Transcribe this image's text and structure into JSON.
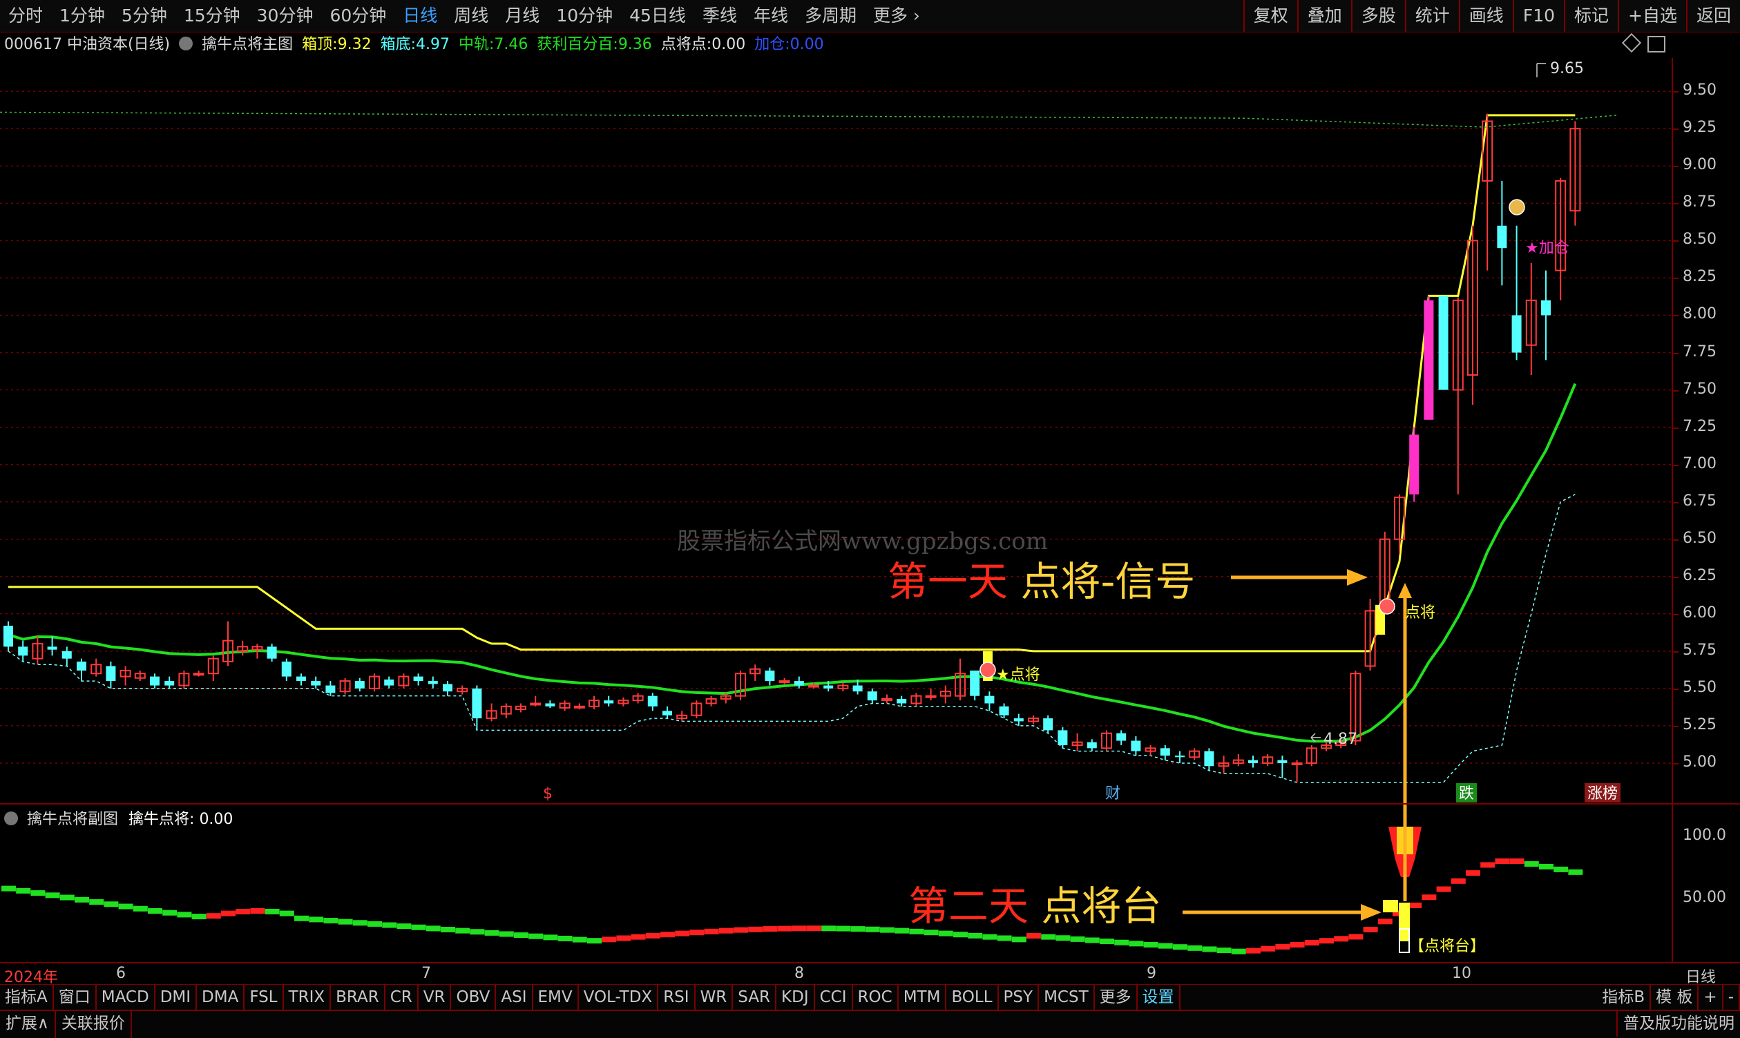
{
  "toolbar": {
    "left": [
      "分时",
      "1分钟",
      "5分钟",
      "15分钟",
      "30分钟",
      "60分钟",
      "日线",
      "周线",
      "月线",
      "10分钟",
      "45日线",
      "季线",
      "年线",
      "多周期",
      "更多"
    ],
    "active": "日线",
    "right": [
      "复权",
      "叠加",
      "多股",
      "统计",
      "画线",
      "F10",
      "标记",
      "+自选",
      "返回"
    ]
  },
  "info": {
    "stock": "000617 中油资本(日线)",
    "indicator": "擒牛点将主图",
    "box_top_label": "箱顶:",
    "box_top": "9.32",
    "box_bottom_label": "箱底:",
    "box_bottom": "4.97",
    "mid_label": "中轨:",
    "mid": "7.46",
    "profit_label": "获利百分百:",
    "profit": "9.36",
    "point_label": "点将点:",
    "point": "0.00",
    "add_label": "加仓:",
    "add": "0.00"
  },
  "colors": {
    "up": "#ff3a3a",
    "down": "#54ffff",
    "yellow": "#ffff30",
    "green": "#20e020",
    "magenta": "#ff30c8",
    "grid": "#7a0000"
  },
  "y_axis_main": [
    "9.50",
    "9.25",
    "9.00",
    "8.75",
    "8.50",
    "8.25",
    "8.00",
    "7.75",
    "7.50",
    "7.25",
    "7.00",
    "6.75",
    "6.50",
    "6.25",
    "6.00",
    "5.75",
    "5.50",
    "5.25",
    "5.00"
  ],
  "y_axis_sub": [
    "100.0",
    "50.00"
  ],
  "chart_labels": {
    "high": "9.65",
    "low": "4.87",
    "add_position": "★加仓",
    "point_mark": "点将",
    "point_mark2": "★点将",
    "stage": "【点将台】"
  },
  "markers": {
    "dollar": "$",
    "cai": "财",
    "die": "跌",
    "zhangbang": "涨榜"
  },
  "sub": {
    "title": "擒牛点将副图",
    "value_label": "擒牛点将:",
    "value": "0.00"
  },
  "dates": {
    "year": "2024年",
    "m6": "6",
    "m7": "7",
    "m8": "8",
    "m9": "9",
    "m10": "10",
    "right": "日线"
  },
  "annotations": {
    "first_red": "第一天",
    "first_yellow": " 点将-信号",
    "second_red": "第二天",
    "second_yellow": " 点将台"
  },
  "watermark": "股票指标公式网www.gpzbgs.com",
  "indicators": [
    "指标A",
    "窗口",
    "MACD",
    "DMI",
    "DMA",
    "FSL",
    "TRIX",
    "BRAR",
    "CR",
    "VR",
    "OBV",
    "ASI",
    "EMV",
    "VOL-TDX",
    "RSI",
    "WR",
    "SAR",
    "KDJ",
    "CCI",
    "ROC",
    "MTM",
    "BOLL",
    "PSY",
    "MCST",
    "更多",
    "设置"
  ],
  "indicators_right": [
    "指标B",
    "模 板",
    "+",
    "-"
  ],
  "bottom": [
    "扩展∧",
    "关联报价"
  ],
  "bottom_right": "普及版功能说明",
  "chart_data": {
    "type": "candlestick",
    "ylim": [
      4.75,
      9.7
    ],
    "candles": [
      [
        5.92,
        5.78,
        5.95,
        5.75
      ],
      [
        5.78,
        5.72,
        5.82,
        5.68
      ],
      [
        5.7,
        5.8,
        5.85,
        5.66
      ],
      [
        5.78,
        5.76,
        5.85,
        5.72
      ],
      [
        5.75,
        5.7,
        5.78,
        5.65
      ],
      [
        5.68,
        5.62,
        5.7,
        5.55
      ],
      [
        5.6,
        5.66,
        5.7,
        5.58
      ],
      [
        5.65,
        5.55,
        5.68,
        5.5
      ],
      [
        5.58,
        5.62,
        5.65,
        5.52
      ],
      [
        5.57,
        5.6,
        5.62,
        5.55
      ],
      [
        5.58,
        5.52,
        5.6,
        5.5
      ],
      [
        5.55,
        5.52,
        5.58,
        5.5
      ],
      [
        5.52,
        5.6,
        5.62,
        5.5
      ],
      [
        5.6,
        5.6,
        5.62,
        5.58
      ],
      [
        5.6,
        5.7,
        5.72,
        5.55
      ],
      [
        5.68,
        5.82,
        5.95,
        5.65
      ],
      [
        5.75,
        5.78,
        5.82,
        5.72
      ],
      [
        5.76,
        5.78,
        5.8,
        5.7
      ],
      [
        5.78,
        5.7,
        5.8,
        5.68
      ],
      [
        5.68,
        5.58,
        5.7,
        5.55
      ],
      [
        5.58,
        5.55,
        5.6,
        5.52
      ],
      [
        5.55,
        5.52,
        5.58,
        5.5
      ],
      [
        5.52,
        5.47,
        5.55,
        5.45
      ],
      [
        5.48,
        5.55,
        5.57,
        5.46
      ],
      [
        5.55,
        5.5,
        5.57,
        5.48
      ],
      [
        5.5,
        5.58,
        5.6,
        5.48
      ],
      [
        5.56,
        5.52,
        5.58,
        5.5
      ],
      [
        5.52,
        5.58,
        5.6,
        5.5
      ],
      [
        5.58,
        5.55,
        5.6,
        5.52
      ],
      [
        5.55,
        5.53,
        5.58,
        5.5
      ],
      [
        5.53,
        5.48,
        5.55,
        5.45
      ],
      [
        5.48,
        5.5,
        5.52,
        5.46
      ],
      [
        5.5,
        5.3,
        5.52,
        5.22
      ],
      [
        5.3,
        5.35,
        5.4,
        5.28
      ],
      [
        5.33,
        5.38,
        5.4,
        5.3
      ],
      [
        5.36,
        5.38,
        5.4,
        5.34
      ],
      [
        5.4,
        5.4,
        5.45,
        5.38
      ],
      [
        5.4,
        5.38,
        5.42,
        5.37
      ],
      [
        5.37,
        5.4,
        5.42,
        5.35
      ],
      [
        5.38,
        5.38,
        5.4,
        5.36
      ],
      [
        5.38,
        5.42,
        5.45,
        5.36
      ],
      [
        5.42,
        5.4,
        5.45,
        5.38
      ],
      [
        5.4,
        5.42,
        5.44,
        5.38
      ],
      [
        5.42,
        5.45,
        5.47,
        5.4
      ],
      [
        5.45,
        5.38,
        5.47,
        5.35
      ],
      [
        5.35,
        5.32,
        5.38,
        5.3
      ],
      [
        5.3,
        5.32,
        5.35,
        5.28
      ],
      [
        5.32,
        5.4,
        5.42,
        5.3
      ],
      [
        5.4,
        5.43,
        5.45,
        5.38
      ],
      [
        5.43,
        5.45,
        5.47,
        5.4
      ],
      [
        5.45,
        5.6,
        5.62,
        5.42
      ],
      [
        5.6,
        5.63,
        5.66,
        5.55
      ],
      [
        5.62,
        5.55,
        5.64,
        5.52
      ],
      [
        5.55,
        5.55,
        5.57,
        5.53
      ],
      [
        5.55,
        5.52,
        5.58,
        5.5
      ],
      [
        5.52,
        5.52,
        5.54,
        5.5
      ],
      [
        5.52,
        5.5,
        5.55,
        5.48
      ],
      [
        5.5,
        5.52,
        5.54,
        5.48
      ],
      [
        5.52,
        5.48,
        5.56,
        5.46
      ],
      [
        5.48,
        5.42,
        5.5,
        5.4
      ],
      [
        5.42,
        5.43,
        5.46,
        5.4
      ],
      [
        5.43,
        5.4,
        5.45,
        5.38
      ],
      [
        5.4,
        5.45,
        5.47,
        5.38
      ],
      [
        5.45,
        5.45,
        5.5,
        5.42
      ],
      [
        5.45,
        5.48,
        5.52,
        5.4
      ],
      [
        5.45,
        5.6,
        5.7,
        5.42
      ],
      [
        5.62,
        5.45,
        5.62,
        5.42
      ],
      [
        5.45,
        5.4,
        5.48,
        5.35
      ],
      [
        5.38,
        5.32,
        5.4,
        5.3
      ],
      [
        5.3,
        5.28,
        5.33,
        5.25
      ],
      [
        5.28,
        5.3,
        5.32,
        5.26
      ],
      [
        5.3,
        5.22,
        5.32,
        5.2
      ],
      [
        5.22,
        5.12,
        5.24,
        5.1
      ],
      [
        5.12,
        5.14,
        5.2,
        5.08
      ],
      [
        5.14,
        5.1,
        5.16,
        5.08
      ],
      [
        5.1,
        5.2,
        5.22,
        5.08
      ],
      [
        5.2,
        5.15,
        5.22,
        5.12
      ],
      [
        5.15,
        5.08,
        5.18,
        5.05
      ],
      [
        5.08,
        5.1,
        5.12,
        5.05
      ],
      [
        5.1,
        5.05,
        5.12,
        5.02
      ],
      [
        5.05,
        5.04,
        5.08,
        5.0
      ],
      [
        5.04,
        5.08,
        5.1,
        5.02
      ],
      [
        5.08,
        4.98,
        5.1,
        4.95
      ],
      [
        4.98,
        5.0,
        5.05,
        4.93
      ],
      [
        5.0,
        5.02,
        5.06,
        4.98
      ],
      [
        5.02,
        5.0,
        5.05,
        4.97
      ],
      [
        5.0,
        5.04,
        5.06,
        4.98
      ],
      [
        5.02,
        5.0,
        5.05,
        4.9
      ],
      [
        5.0,
        5.0,
        5.02,
        4.87
      ],
      [
        5.0,
        5.1,
        5.12,
        4.98
      ],
      [
        5.1,
        5.12,
        5.14,
        5.08
      ],
      [
        5.12,
        5.14,
        5.16,
        5.1
      ],
      [
        5.15,
        5.6,
        5.62,
        5.12
      ],
      [
        5.65,
        6.02,
        6.1,
        5.62
      ],
      [
        6.05,
        6.5,
        6.55,
        6.0
      ],
      [
        6.5,
        6.78,
        6.8,
        6.4
      ],
      [
        6.8,
        7.2,
        7.25,
        6.75
      ],
      [
        7.3,
        8.1,
        8.13,
        7.3
      ],
      [
        8.13,
        7.5,
        8.13,
        7.5
      ],
      [
        7.5,
        8.1,
        8.12,
        6.8
      ],
      [
        7.6,
        8.5,
        8.6,
        7.4
      ],
      [
        8.9,
        9.3,
        9.35,
        8.3
      ],
      [
        8.6,
        8.45,
        8.9,
        8.2
      ],
      [
        8.0,
        7.75,
        8.6,
        7.7
      ],
      [
        7.8,
        8.1,
        8.35,
        7.6
      ],
      [
        8.1,
        8.0,
        8.3,
        7.7
      ],
      [
        8.3,
        8.9,
        8.92,
        8.1
      ],
      [
        8.7,
        9.25,
        9.3,
        8.6
      ]
    ]
  }
}
